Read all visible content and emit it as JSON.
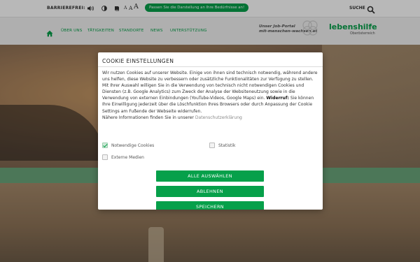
{
  "topbar": {
    "accessibility_label": "BARRIEREFREI:",
    "font_small": "A",
    "font_medium": "A",
    "font_large": "A",
    "adjust_pill": "Passen Sie die Darstellung an Ihre Bedürfnisse an!",
    "search_label": "SUCHE",
    "icons": [
      "speaker-icon",
      "contrast-icon",
      "book-icon",
      "search-icon"
    ]
  },
  "nav": {
    "items": [
      "ÜBER UNS",
      "TÄTIGKEITEN",
      "STANDORTE",
      "NEWS",
      "UNTERSTÜTZUNG"
    ]
  },
  "brand": {
    "portal_line1": "Unser Job-Portal",
    "portal_line2": "mit-menschen-wachsen.at",
    "name": "lebenshilfe",
    "region": "Oberösterreich",
    "accent_color": "#06a04a"
  },
  "cookie": {
    "title": "COOKIE EINSTELLUNGEN",
    "text_part1": "Wir nutzen Cookies auf unserer Website. Einige von ihnen sind technisch notwendig, während andere uns helfen, diese Website zu verbessern oder zusätzliche Funktionalitäten zur Verfügung zu stellen. Mit Ihrer Auswahl willigen Sie in die Verwendung von technisch nicht notwendigen Cookies und Diensten (z.B. Google Analytics) zum Zweck der Analyse der Websiteneutzung sowie in die Verwendung von externen Einbindungen (YouTube-Videos, Google Maps) ein.",
    "withdraw_label": "Widerruf:",
    "text_part2": "Sie können Ihre Einwilligung jederzeit über die Löschfunktion Ihres Browsers oder durch Anpassung der Cookie Settings am Fußende der Webseite widerrufen.",
    "more_info": "Nähere Informationen finden Sie in unserer",
    "privacy_link": "Datenschutzerklärung",
    "options": [
      {
        "label": "Notwendige Cookies",
        "checked": true
      },
      {
        "label": "Statistik",
        "checked": false
      },
      {
        "label": "Externe Medien",
        "checked": false
      }
    ],
    "buttons": {
      "accept_all": "ALLE AUSWÄHLEN",
      "reject": "ABLEHNEN",
      "save": "SPEICHERN"
    }
  }
}
